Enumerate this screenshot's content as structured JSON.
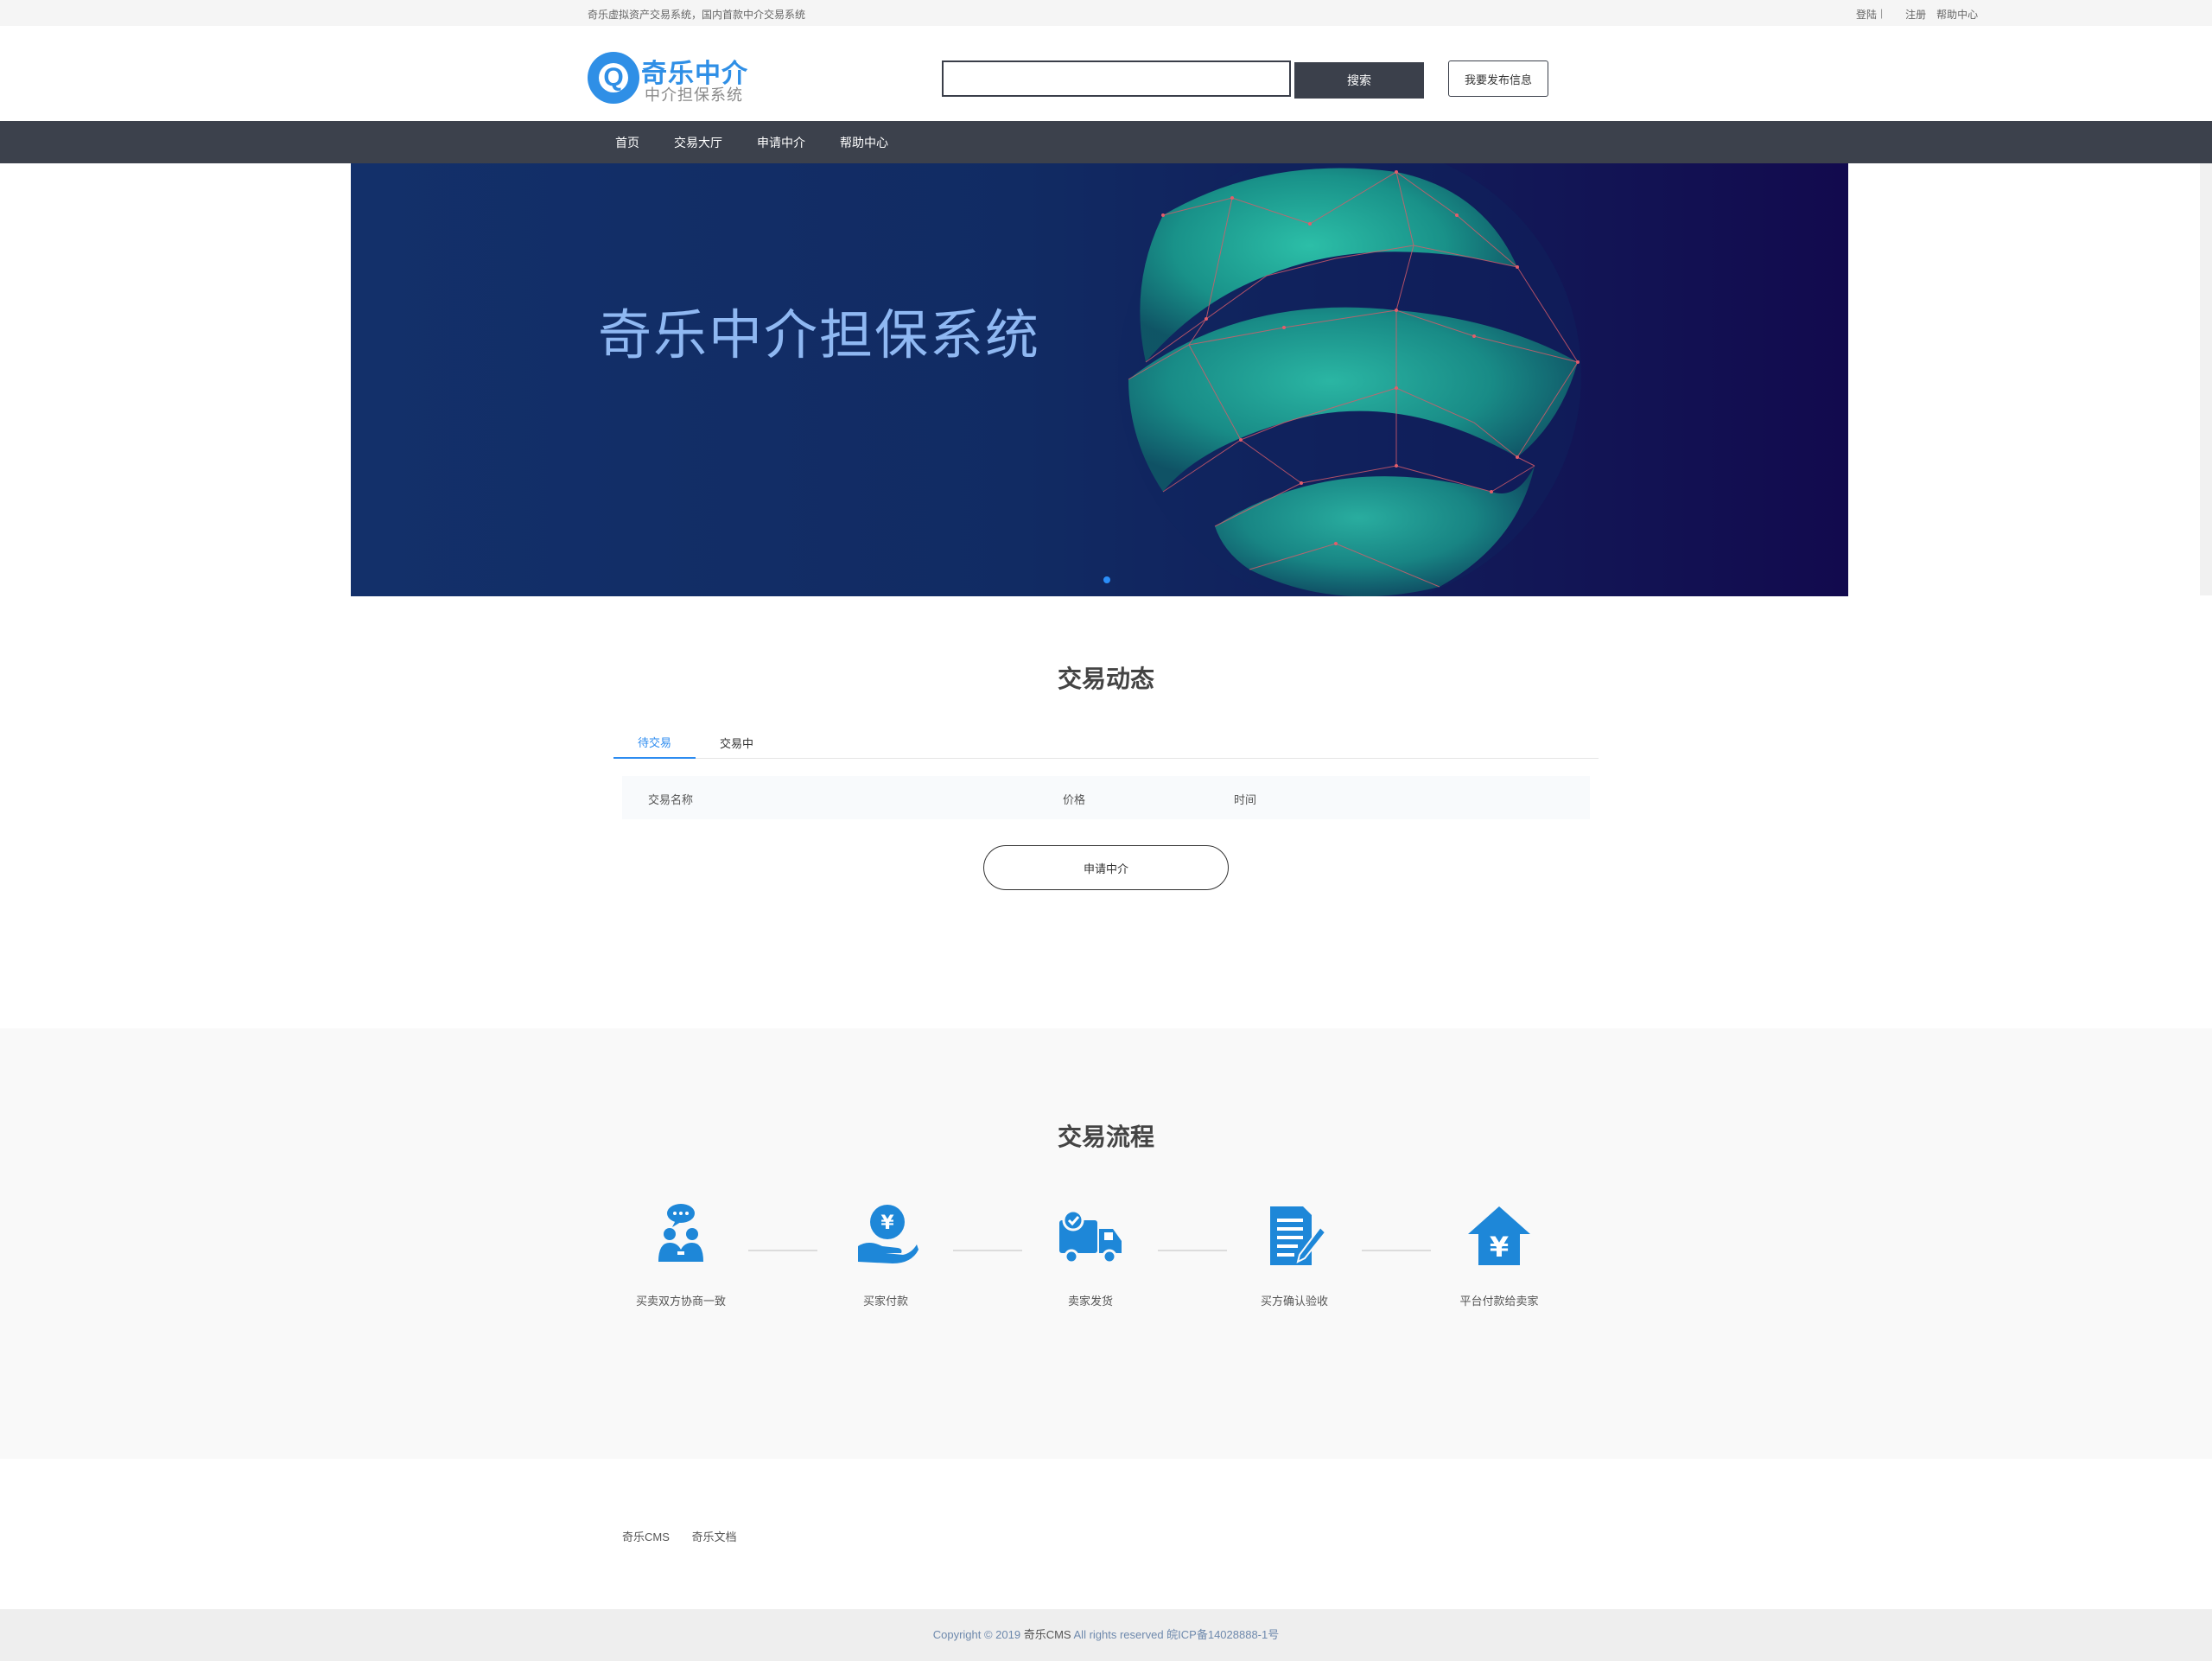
{
  "topbar": {
    "tagline": "奇乐虚拟资产交易系统，国内首款中介交易系统",
    "login": "登陆",
    "separator": "|",
    "register": "注册",
    "help": "帮助中心"
  },
  "header": {
    "logo_letter": "Q",
    "logo_title": "奇乐中介",
    "logo_subtitle": "中介担保系统",
    "search_value": "",
    "search_button": "搜索",
    "publish_button": "我要发布信息"
  },
  "nav": {
    "items": [
      "首页",
      "交易大厅",
      "申请中介",
      "帮助中心"
    ]
  },
  "banner": {
    "headline": "奇乐中介担保系统"
  },
  "trade": {
    "title": "交易动态",
    "tabs": [
      "待交易",
      "交易中"
    ],
    "columns": [
      "交易名称",
      "价格",
      "时间"
    ],
    "apply_button": "申请中介"
  },
  "flow": {
    "title": "交易流程",
    "steps": [
      {
        "label": "买卖双方协商一致",
        "icon": "negotiate-icon"
      },
      {
        "label": "买家付款",
        "icon": "payment-icon"
      },
      {
        "label": "卖家发货",
        "icon": "delivery-truck-icon"
      },
      {
        "label": "买方确认验收",
        "icon": "confirm-document-icon"
      },
      {
        "label": "平台付款给卖家",
        "icon": "house-yen-icon"
      }
    ],
    "accent": "#1e87d8"
  },
  "footer": {
    "links": [
      "奇乐CMS",
      "奇乐文档"
    ],
    "copyright_prefix": "Copyright © 2019",
    "copyright_brand": "奇乐CMS",
    "copyright_suffix": "All rights reserved 皖ICP备14028888-1号"
  },
  "colors": {
    "brand": "#2f8fe6",
    "nav_bg": "#3c414c",
    "tab_active": "#2d8cf0"
  }
}
